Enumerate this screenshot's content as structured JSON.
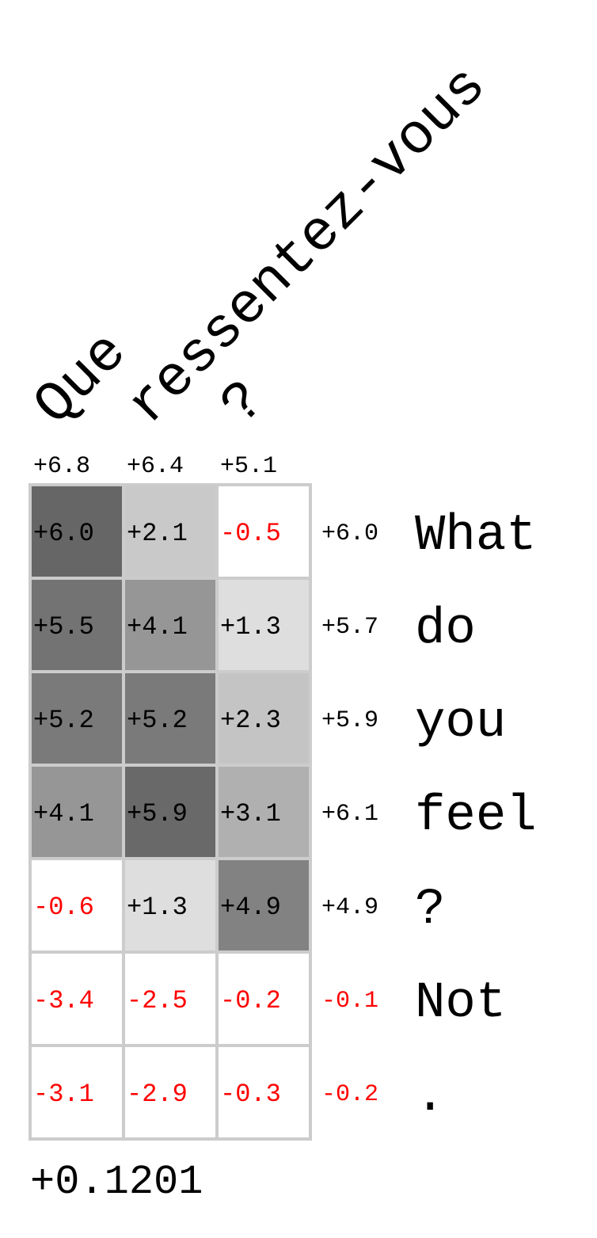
{
  "chart_data": {
    "type": "heatmap",
    "x_tokens": [
      "Que",
      "ressentez-vous",
      "?"
    ],
    "y_tokens": [
      "What",
      "do",
      "you",
      "feel",
      "?",
      "Not",
      "."
    ],
    "column_max": [
      "+6.8",
      "+6.4",
      "+5.1"
    ],
    "row_max": [
      "+6.0",
      "+5.7",
      "+5.9",
      "+6.1",
      "+4.9",
      "-0.1",
      "-0.2"
    ],
    "values": [
      [
        6.0,
        2.1,
        -0.5
      ],
      [
        5.5,
        4.1,
        1.3
      ],
      [
        5.2,
        5.2,
        2.3
      ],
      [
        4.1,
        5.9,
        3.1
      ],
      [
        -0.6,
        1.3,
        4.9
      ],
      [
        -3.4,
        -2.5,
        -0.2
      ],
      [
        -3.1,
        -2.9,
        -0.3
      ]
    ],
    "labels": [
      [
        "+6.0",
        "+2.1",
        "-0.5"
      ],
      [
        "+5.5",
        "+4.1",
        "+1.3"
      ],
      [
        "+5.2",
        "+5.2",
        "+2.3"
      ],
      [
        "+4.1",
        "+5.9",
        "+3.1"
      ],
      [
        "-0.6",
        "+1.3",
        "+4.9"
      ],
      [
        "-3.4",
        "-2.5",
        "-0.2"
      ],
      [
        "-3.1",
        "-2.9",
        "-0.3"
      ]
    ],
    "score": "+0.1201",
    "color_min": 0,
    "color_max": 6.0,
    "negative_color": "#ff0000",
    "positive_color": "#000000",
    "grid_color": "#cccccc"
  }
}
